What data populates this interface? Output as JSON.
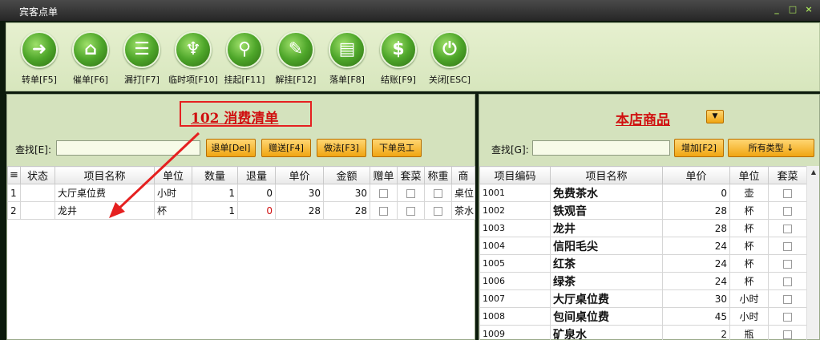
{
  "window": {
    "title": "宾客点单",
    "controls": [
      "_",
      "□",
      "×"
    ]
  },
  "toolbar": {
    "buttons": [
      {
        "label": "转单[F5]",
        "icon": "➜"
      },
      {
        "label": "催单[F6]",
        "icon": "⌂"
      },
      {
        "label": "漏打[F7]",
        "icon": "☰"
      },
      {
        "label": "临时项[F10]",
        "icon": "♆"
      },
      {
        "label": "挂起[F11]",
        "icon": "⚲"
      },
      {
        "label": "解挂[F12]",
        "icon": "✎"
      },
      {
        "label": "落单[F8]",
        "icon": "▤"
      },
      {
        "label": "结账[F9]",
        "icon": "$"
      },
      {
        "label": "关闭[ESC]",
        "icon": "⏻"
      }
    ]
  },
  "left": {
    "title": "102  消费清单",
    "search_label": "查找[E]:",
    "search_value": "",
    "buttons": [
      "退单[Del]",
      "赠送[F4]",
      "做法[F3]",
      "下单员工"
    ],
    "columns": [
      "≡",
      "状态",
      "项目名称",
      "单位",
      "数量",
      "退量",
      "单价",
      "金额",
      "赠单",
      "套菜",
      "称重",
      "商"
    ],
    "rows": [
      {
        "idx": "1",
        "status": "",
        "name": "大厅桌位费",
        "unit": "小时",
        "qty": "1",
        "ret": "0",
        "price": "30",
        "amount": "30",
        "extra": "桌位"
      },
      {
        "idx": "2",
        "status": "",
        "name": "龙井",
        "unit": "杯",
        "qty": "1",
        "ret": "0",
        "price": "28",
        "amount": "28",
        "extra": "茶水"
      }
    ]
  },
  "right": {
    "title": "本店商品",
    "search_label": "查找[G]:",
    "search_value": "",
    "add_button": "增加[F2]",
    "type_button": "所有类型 ↓",
    "columns": [
      "项目编码",
      "项目名称",
      "单价",
      "单位",
      "套菜"
    ],
    "rows": [
      {
        "code": "1001",
        "name": "免费茶水",
        "price": "0",
        "unit": "壶"
      },
      {
        "code": "1002",
        "name": "铁观音",
        "price": "28",
        "unit": "杯"
      },
      {
        "code": "1003",
        "name": "龙井",
        "price": "28",
        "unit": "杯"
      },
      {
        "code": "1004",
        "name": "信阳毛尖",
        "price": "24",
        "unit": "杯"
      },
      {
        "code": "1005",
        "name": "红茶",
        "price": "24",
        "unit": "杯"
      },
      {
        "code": "1006",
        "name": "绿茶",
        "price": "24",
        "unit": "杯"
      },
      {
        "code": "1007",
        "name": "大厅桌位费",
        "price": "30",
        "unit": "小时"
      },
      {
        "code": "1008",
        "name": "包间桌位费",
        "price": "45",
        "unit": "小时"
      },
      {
        "code": "1009",
        "name": "矿泉水",
        "price": "2",
        "unit": "瓶"
      }
    ]
  },
  "colors": {
    "accent_green": "#4ea62a",
    "title_red": "#d01010",
    "button_orange": "#f0a512",
    "panel_bg": "#d4e2bd"
  }
}
